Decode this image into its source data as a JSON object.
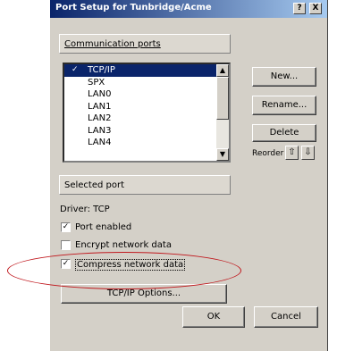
{
  "window": {
    "title": "Port Setup for Tunbridge/Acme",
    "help_btn": "?",
    "close_btn": "X"
  },
  "comm_ports": {
    "heading": "Communication ports",
    "items": [
      {
        "label": "TCP/IP",
        "selected": true,
        "checked": true
      },
      {
        "label": "SPX"
      },
      {
        "label": "LAN0"
      },
      {
        "label": "LAN1"
      },
      {
        "label": "LAN2"
      },
      {
        "label": "LAN3"
      },
      {
        "label": "LAN4"
      }
    ]
  },
  "buttons": {
    "new": "New...",
    "rename": "Rename...",
    "delete": "Delete",
    "reorder": "Reorder",
    "tcpip_options": "TCP/IP Options...",
    "ok": "OK",
    "cancel": "Cancel"
  },
  "selected_port": {
    "heading": "Selected port",
    "driver": "Driver: TCP",
    "options": [
      {
        "label": "Port enabled",
        "checked": true
      },
      {
        "label": "Encrypt network data",
        "checked": false
      },
      {
        "label": "Compress network data",
        "checked": true
      }
    ]
  },
  "annotation": {
    "color": "#c0171d"
  }
}
